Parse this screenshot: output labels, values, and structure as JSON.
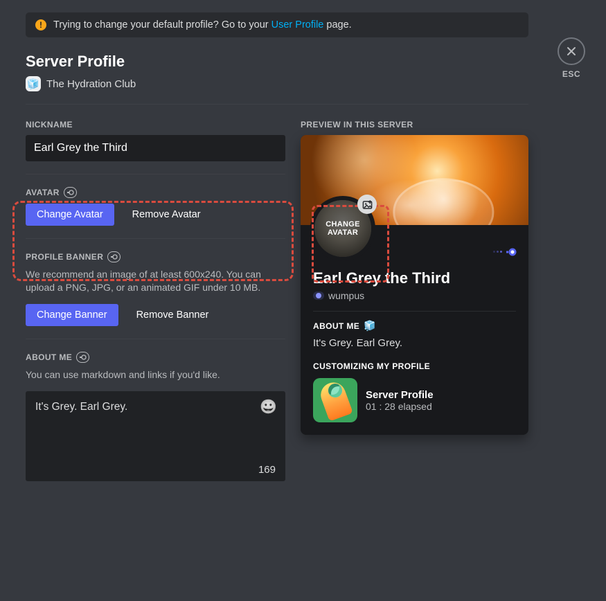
{
  "notice": {
    "text_pre": "Trying to change your default profile? Go to your ",
    "link": "User Profile",
    "text_post": " page."
  },
  "title": "Server Profile",
  "server": {
    "name": "The Hydration Club"
  },
  "esc_label": "ESC",
  "labels": {
    "nickname": "Nickname",
    "avatar": "Avatar",
    "banner": "Profile Banner",
    "about": "About Me",
    "preview": "Preview in this Server"
  },
  "nickname_value": "Earl Grey the Third",
  "buttons": {
    "change_avatar": "Change Avatar",
    "remove_avatar": "Remove Avatar",
    "change_banner": "Change Banner",
    "remove_banner": "Remove Banner"
  },
  "banner_help": "We recommend an image of at least 600x240. You can upload a PNG, JPG, or an animated GIF under 10 MB.",
  "about_help": "You can use markdown and links if you'd like.",
  "about_text": "It's Grey. Earl Grey.",
  "about_remaining": "169",
  "preview": {
    "change_avatar_overlay": "CHANGE AVATAR",
    "display_name": "Earl Grey the Third",
    "username": "wumpus",
    "about_head": "About Me",
    "about_text": "It's Grey. Earl Grey.",
    "activity_head": "Customizing My Profile",
    "activity_title": "Server Profile",
    "activity_elapsed": "01 : 28 elapsed"
  }
}
